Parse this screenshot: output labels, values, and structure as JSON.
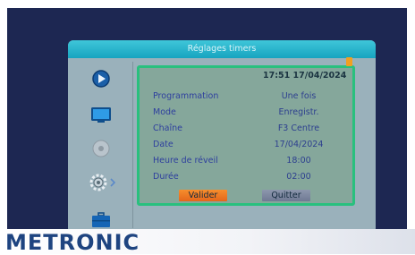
{
  "window": {
    "title": "Réglages timers"
  },
  "sidebar": {
    "items": [
      {
        "icon": "play-icon"
      },
      {
        "icon": "tv-icon"
      },
      {
        "icon": "disc-icon"
      },
      {
        "icon": "gear-icon",
        "selected": true
      },
      {
        "icon": "briefcase-icon"
      }
    ]
  },
  "dialog": {
    "clock": "17:51 17/04/2024",
    "fields": [
      {
        "label": "Programmation",
        "value": "Une fois"
      },
      {
        "label": "Mode",
        "value": "Enregistr."
      },
      {
        "label": "Chaîne",
        "value": "F3 Centre"
      },
      {
        "label": "Date",
        "value": "17/04/2024"
      },
      {
        "label": "Heure de réveil",
        "value": "18:00"
      },
      {
        "label": "Durée",
        "value": "02:00"
      }
    ],
    "buttons": {
      "ok": "Valider",
      "quit": "Quitter"
    }
  },
  "brand": {
    "name": "METRONIC"
  },
  "colors": {
    "screen_bg": "#1d2752",
    "window_bg": "#9ab1bb",
    "title_bar": "#17a4c0",
    "dialog_bg": "#85a79b",
    "dialog_border": "#29c07e",
    "label_text": "#2e3f9e",
    "ok_button": "#f78e2d",
    "quit_button": "#6f7993",
    "brand": "#1e4480"
  }
}
